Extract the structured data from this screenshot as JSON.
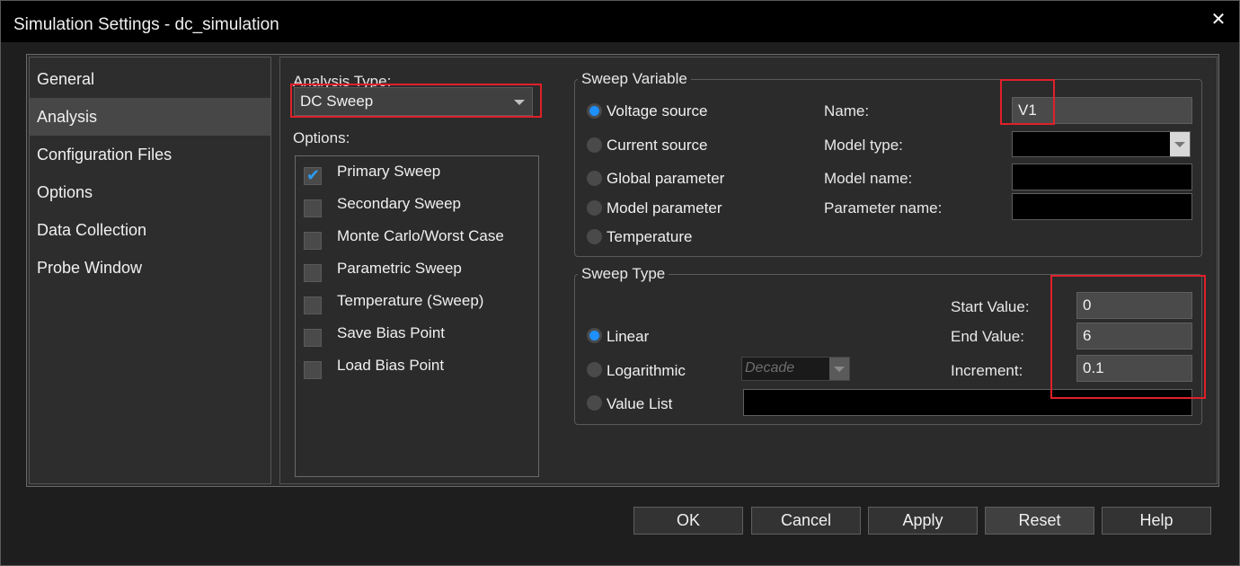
{
  "window": {
    "title": "Simulation Settings - dc_simulation",
    "close_glyph": "✕"
  },
  "nav": {
    "items": [
      {
        "label": "General",
        "active": false
      },
      {
        "label": "Analysis",
        "active": true
      },
      {
        "label": "Configuration Files",
        "active": false
      },
      {
        "label": "Options",
        "active": false
      },
      {
        "label": "Data Collection",
        "active": false
      },
      {
        "label": "Probe Window",
        "active": false
      }
    ]
  },
  "analysis": {
    "type_label": "Analysis Type:",
    "type_value": "DC Sweep",
    "options_label": "Options:",
    "options": [
      {
        "label": "Primary Sweep",
        "checked": true
      },
      {
        "label": "Secondary Sweep",
        "checked": false
      },
      {
        "label": "Monte Carlo/Worst Case",
        "checked": false
      },
      {
        "label": "Parametric Sweep",
        "checked": false
      },
      {
        "label": "Temperature (Sweep)",
        "checked": false
      },
      {
        "label": "Save Bias Point",
        "checked": false
      },
      {
        "label": "Load Bias Point",
        "checked": false
      }
    ]
  },
  "sweep_variable": {
    "legend": "Sweep Variable",
    "radios": [
      {
        "label": "Voltage source",
        "selected": true
      },
      {
        "label": "Current source",
        "selected": false
      },
      {
        "label": "Global parameter",
        "selected": false
      },
      {
        "label": "Model parameter",
        "selected": false
      },
      {
        "label": "Temperature",
        "selected": false
      }
    ],
    "name_label": "Name:",
    "name_value": "V1",
    "model_type_label": "Model type:",
    "model_type_value": "",
    "model_name_label": "Model name:",
    "model_name_value": "",
    "param_name_label": "Parameter name:",
    "param_name_value": ""
  },
  "sweep_type": {
    "legend": "Sweep Type",
    "radios": [
      {
        "label": "Linear",
        "selected": true
      },
      {
        "label": "Logarithmic",
        "selected": false
      },
      {
        "label": "Value List",
        "selected": false
      }
    ],
    "log_scale_value": "Decade",
    "start_label": "Start Value:",
    "start_value": "0",
    "end_label": "End Value:",
    "end_value": "6",
    "increment_label": "Increment:",
    "increment_value": "0.1",
    "value_list_value": ""
  },
  "buttons": {
    "ok": "OK",
    "cancel": "Cancel",
    "apply": "Apply",
    "reset": "Reset",
    "help": "Help"
  },
  "colors": {
    "accent": "#1e90ff",
    "highlight": "#e0202a",
    "check": "#2e9bf0"
  }
}
